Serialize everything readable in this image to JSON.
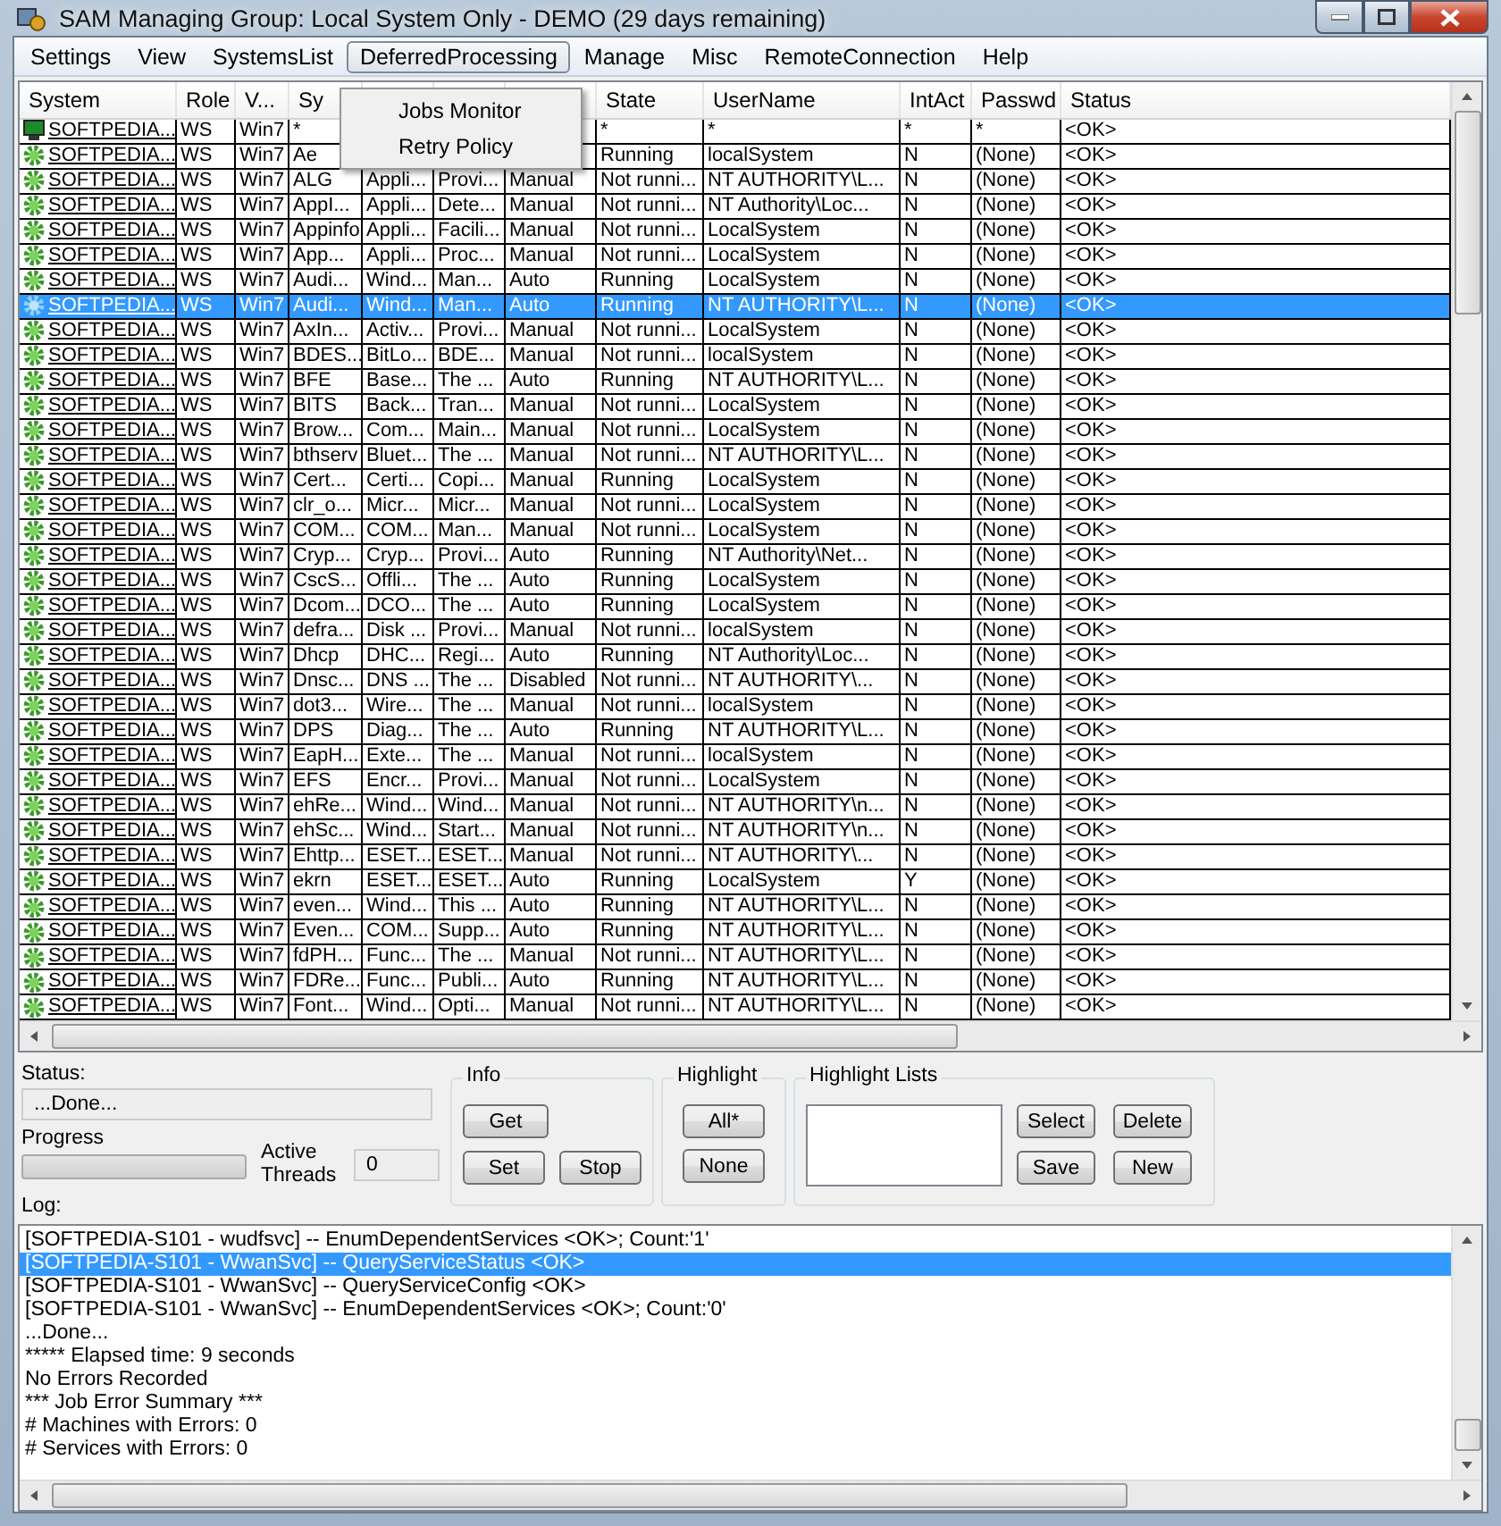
{
  "window": {
    "title": "SAM Managing Group: Local System Only - DEMO (29 days remaining)"
  },
  "menu_bar": [
    {
      "label": "Settings",
      "selected": false
    },
    {
      "label": "View",
      "selected": false
    },
    {
      "label": "SystemsList",
      "selected": false
    },
    {
      "label": "DeferredProcessing",
      "selected": true
    },
    {
      "label": "Manage",
      "selected": false
    },
    {
      "label": "Misc",
      "selected": false
    },
    {
      "label": "RemoteConnection",
      "selected": false
    },
    {
      "label": "Help",
      "selected": false
    }
  ],
  "open_menu": {
    "items": [
      "Jobs Monitor",
      "Retry Policy"
    ]
  },
  "table": {
    "columns": [
      {
        "label": "System"
      },
      {
        "label": "Role"
      },
      {
        "label": "V..."
      },
      {
        "label": "Sy"
      },
      {},
      {},
      {},
      {
        "label": "State"
      },
      {
        "label": "UserName"
      },
      {
        "label": "IntAct"
      },
      {
        "label": "Passwd"
      },
      {
        "label": "Status"
      }
    ],
    "rows": [
      {
        "kind": "computer",
        "selected": false,
        "cells": [
          "SOFTPEDIA...",
          "WS",
          "Win7",
          "*",
          "",
          "",
          "",
          "*",
          "*",
          "*",
          "*",
          "<OK>"
        ]
      },
      {
        "kind": "service",
        "selected": false,
        "cells": [
          "SOFTPEDIA...",
          "WS",
          "Win7",
          "Ae",
          "",
          "",
          "",
          "Running",
          "localSystem",
          "N",
          "(None)",
          "<OK>"
        ]
      },
      {
        "kind": "service",
        "selected": false,
        "cells": [
          "SOFTPEDIA...",
          "WS",
          "Win7",
          "ALG",
          "Appli...",
          "Provi...",
          "Manual",
          "Not runni...",
          "NT AUTHORITY\\L...",
          "N",
          "(None)",
          "<OK>"
        ]
      },
      {
        "kind": "service",
        "selected": false,
        "cells": [
          "SOFTPEDIA...",
          "WS",
          "Win7",
          "AppI...",
          "Appli...",
          "Dete...",
          "Manual",
          "Not runni...",
          "NT Authority\\Loc...",
          "N",
          "(None)",
          "<OK>"
        ]
      },
      {
        "kind": "service",
        "selected": false,
        "cells": [
          "SOFTPEDIA...",
          "WS",
          "Win7",
          "Appinfo",
          "Appli...",
          "Facili...",
          "Manual",
          "Not runni...",
          "LocalSystem",
          "N",
          "(None)",
          "<OK>"
        ]
      },
      {
        "kind": "service",
        "selected": false,
        "cells": [
          "SOFTPEDIA...",
          "WS",
          "Win7",
          "App...",
          "Appli...",
          "Proc...",
          "Manual",
          "Not runni...",
          "LocalSystem",
          "N",
          "(None)",
          "<OK>"
        ]
      },
      {
        "kind": "service",
        "selected": false,
        "cells": [
          "SOFTPEDIA...",
          "WS",
          "Win7",
          "Audi...",
          "Wind...",
          "Man...",
          "Auto",
          "Running",
          "LocalSystem",
          "N",
          "(None)",
          "<OK>"
        ]
      },
      {
        "kind": "service",
        "selected": true,
        "cells": [
          "SOFTPEDIA...",
          "WS",
          "Win7",
          "Audi...",
          "Wind...",
          "Man...",
          "Auto",
          "Running",
          "NT AUTHORITY\\L...",
          "N",
          "(None)",
          "<OK>"
        ]
      },
      {
        "kind": "service",
        "selected": false,
        "cells": [
          "SOFTPEDIA...",
          "WS",
          "Win7",
          "AxIn...",
          "Activ...",
          "Provi...",
          "Manual",
          "Not runni...",
          "LocalSystem",
          "N",
          "(None)",
          "<OK>"
        ]
      },
      {
        "kind": "service",
        "selected": false,
        "cells": [
          "SOFTPEDIA...",
          "WS",
          "Win7",
          "BDES...",
          "BitLo...",
          "BDE...",
          "Manual",
          "Not runni...",
          "localSystem",
          "N",
          "(None)",
          "<OK>"
        ]
      },
      {
        "kind": "service",
        "selected": false,
        "cells": [
          "SOFTPEDIA...",
          "WS",
          "Win7",
          "BFE",
          "Base...",
          "The ...",
          "Auto",
          "Running",
          "NT AUTHORITY\\L...",
          "N",
          "(None)",
          "<OK>"
        ]
      },
      {
        "kind": "service",
        "selected": false,
        "cells": [
          "SOFTPEDIA...",
          "WS",
          "Win7",
          "BITS",
          "Back...",
          "Tran...",
          "Manual",
          "Not runni...",
          "LocalSystem",
          "N",
          "(None)",
          "<OK>"
        ]
      },
      {
        "kind": "service",
        "selected": false,
        "cells": [
          "SOFTPEDIA...",
          "WS",
          "Win7",
          "Brow...",
          "Com...",
          "Main...",
          "Manual",
          "Not runni...",
          "LocalSystem",
          "N",
          "(None)",
          "<OK>"
        ]
      },
      {
        "kind": "service",
        "selected": false,
        "cells": [
          "SOFTPEDIA...",
          "WS",
          "Win7",
          "bthserv",
          "Bluet...",
          "The ...",
          "Manual",
          "Not runni...",
          "NT AUTHORITY\\L...",
          "N",
          "(None)",
          "<OK>"
        ]
      },
      {
        "kind": "service",
        "selected": false,
        "cells": [
          "SOFTPEDIA...",
          "WS",
          "Win7",
          "Cert...",
          "Certi...",
          "Copi...",
          "Manual",
          "Running",
          "LocalSystem",
          "N",
          "(None)",
          "<OK>"
        ]
      },
      {
        "kind": "service",
        "selected": false,
        "cells": [
          "SOFTPEDIA...",
          "WS",
          "Win7",
          "clr_o...",
          "Micr...",
          "Micr...",
          "Manual",
          "Not runni...",
          "LocalSystem",
          "N",
          "(None)",
          "<OK>"
        ]
      },
      {
        "kind": "service",
        "selected": false,
        "cells": [
          "SOFTPEDIA...",
          "WS",
          "Win7",
          "COM...",
          "COM...",
          "Man...",
          "Manual",
          "Not runni...",
          "LocalSystem",
          "N",
          "(None)",
          "<OK>"
        ]
      },
      {
        "kind": "service",
        "selected": false,
        "cells": [
          "SOFTPEDIA...",
          "WS",
          "Win7",
          "Cryp...",
          "Cryp...",
          "Provi...",
          "Auto",
          "Running",
          "NT Authority\\Net...",
          "N",
          "(None)",
          "<OK>"
        ]
      },
      {
        "kind": "service",
        "selected": false,
        "cells": [
          "SOFTPEDIA...",
          "WS",
          "Win7",
          "CscS...",
          "Offli...",
          "The ...",
          "Auto",
          "Running",
          "LocalSystem",
          "N",
          "(None)",
          "<OK>"
        ]
      },
      {
        "kind": "service",
        "selected": false,
        "cells": [
          "SOFTPEDIA...",
          "WS",
          "Win7",
          "Dcom...",
          "DCO...",
          "The ...",
          "Auto",
          "Running",
          "LocalSystem",
          "N",
          "(None)",
          "<OK>"
        ]
      },
      {
        "kind": "service",
        "selected": false,
        "cells": [
          "SOFTPEDIA...",
          "WS",
          "Win7",
          "defra...",
          "Disk ...",
          "Provi...",
          "Manual",
          "Not runni...",
          "localSystem",
          "N",
          "(None)",
          "<OK>"
        ]
      },
      {
        "kind": "service",
        "selected": false,
        "cells": [
          "SOFTPEDIA...",
          "WS",
          "Win7",
          "Dhcp",
          "DHC...",
          "Regi...",
          "Auto",
          "Running",
          "NT Authority\\Loc...",
          "N",
          "(None)",
          "<OK>"
        ]
      },
      {
        "kind": "service",
        "selected": false,
        "cells": [
          "SOFTPEDIA...",
          "WS",
          "Win7",
          "Dnsc...",
          "DNS ...",
          "The ...",
          "Disabled",
          "Not runni...",
          "NT AUTHORITY\\...",
          "N",
          "(None)",
          "<OK>"
        ]
      },
      {
        "kind": "service",
        "selected": false,
        "cells": [
          "SOFTPEDIA...",
          "WS",
          "Win7",
          "dot3...",
          "Wire...",
          "The ...",
          "Manual",
          "Not runni...",
          "localSystem",
          "N",
          "(None)",
          "<OK>"
        ]
      },
      {
        "kind": "service",
        "selected": false,
        "cells": [
          "SOFTPEDIA...",
          "WS",
          "Win7",
          "DPS",
          "Diag...",
          "The ...",
          "Auto",
          "Running",
          "NT AUTHORITY\\L...",
          "N",
          "(None)",
          "<OK>"
        ]
      },
      {
        "kind": "service",
        "selected": false,
        "cells": [
          "SOFTPEDIA...",
          "WS",
          "Win7",
          "EapH...",
          "Exte...",
          "The ...",
          "Manual",
          "Not runni...",
          "localSystem",
          "N",
          "(None)",
          "<OK>"
        ]
      },
      {
        "kind": "service",
        "selected": false,
        "cells": [
          "SOFTPEDIA...",
          "WS",
          "Win7",
          "EFS",
          "Encr...",
          "Provi...",
          "Manual",
          "Not runni...",
          "LocalSystem",
          "N",
          "(None)",
          "<OK>"
        ]
      },
      {
        "kind": "service",
        "selected": false,
        "cells": [
          "SOFTPEDIA...",
          "WS",
          "Win7",
          "ehRe...",
          "Wind...",
          "Wind...",
          "Manual",
          "Not runni...",
          "NT AUTHORITY\\n...",
          "N",
          "(None)",
          "<OK>"
        ]
      },
      {
        "kind": "service",
        "selected": false,
        "cells": [
          "SOFTPEDIA...",
          "WS",
          "Win7",
          "ehSc...",
          "Wind...",
          "Start...",
          "Manual",
          "Not runni...",
          "NT AUTHORITY\\n...",
          "N",
          "(None)",
          "<OK>"
        ]
      },
      {
        "kind": "service",
        "selected": false,
        "cells": [
          "SOFTPEDIA...",
          "WS",
          "Win7",
          "Ehttp...",
          "ESET...",
          "ESET...",
          "Manual",
          "Not runni...",
          "NT AUTHORITY\\...",
          "N",
          "(None)",
          "<OK>"
        ]
      },
      {
        "kind": "service",
        "selected": false,
        "cells": [
          "SOFTPEDIA...",
          "WS",
          "Win7",
          "ekrn",
          "ESET...",
          "ESET...",
          "Auto",
          "Running",
          "LocalSystem",
          "Y",
          "(None)",
          "<OK>"
        ]
      },
      {
        "kind": "service",
        "selected": false,
        "cells": [
          "SOFTPEDIA...",
          "WS",
          "Win7",
          "even...",
          "Wind...",
          "This ...",
          "Auto",
          "Running",
          "NT AUTHORITY\\L...",
          "N",
          "(None)",
          "<OK>"
        ]
      },
      {
        "kind": "service",
        "selected": false,
        "cells": [
          "SOFTPEDIA...",
          "WS",
          "Win7",
          "Even...",
          "COM...",
          "Supp...",
          "Auto",
          "Running",
          "NT AUTHORITY\\L...",
          "N",
          "(None)",
          "<OK>"
        ]
      },
      {
        "kind": "service",
        "selected": false,
        "cells": [
          "SOFTPEDIA...",
          "WS",
          "Win7",
          "fdPH...",
          "Func...",
          "The ...",
          "Manual",
          "Not runni...",
          "NT AUTHORITY\\L...",
          "N",
          "(None)",
          "<OK>"
        ]
      },
      {
        "kind": "service",
        "selected": false,
        "cells": [
          "SOFTPEDIA...",
          "WS",
          "Win7",
          "FDRe...",
          "Func...",
          "Publi...",
          "Auto",
          "Running",
          "NT AUTHORITY\\L...",
          "N",
          "(None)",
          "<OK>"
        ]
      },
      {
        "kind": "service",
        "selected": false,
        "cells": [
          "SOFTPEDIA...",
          "WS",
          "Win7",
          "Font...",
          "Wind...",
          "Opti...",
          "Manual",
          "Not runni...",
          "NT AUTHORITY\\L...",
          "N",
          "(None)",
          "<OK>"
        ]
      }
    ]
  },
  "status": {
    "label": "Status:",
    "value": "...Done..."
  },
  "progress": {
    "label": "Progress",
    "level": 0
  },
  "active_threads": {
    "label": "Active Threads",
    "value": "0"
  },
  "info_group": {
    "title": "Info",
    "buttons": [
      "Get",
      "Set",
      "Stop"
    ]
  },
  "highlight_group": {
    "title": "Highlight",
    "buttons": [
      "All*",
      "None"
    ]
  },
  "highlight_lists_group": {
    "title": "Highlight Lists",
    "buttons": [
      "Select",
      "Delete",
      "Save",
      "New"
    ]
  },
  "log": {
    "label": "Log:",
    "lines": [
      {
        "text": "[SOFTPEDIA-S101 - wudfsvc] -- EnumDependentServices <OK>; Count:'1'",
        "selected": false
      },
      {
        "text": "[SOFTPEDIA-S101 - WwanSvc] -- QueryServiceStatus <OK>",
        "selected": true
      },
      {
        "text": "[SOFTPEDIA-S101 - WwanSvc] -- QueryServiceConfig <OK>",
        "selected": false
      },
      {
        "text": "[SOFTPEDIA-S101 - WwanSvc] -- EnumDependentServices <OK>; Count:'0'",
        "selected": false
      },
      {
        "text": "...Done...",
        "selected": false
      },
      {
        "text": "***** Elapsed time: 9 seconds",
        "selected": false
      },
      {
        "text": "No Errors Recorded",
        "selected": false
      },
      {
        "text": "*** Job Error Summary ***",
        "selected": false
      },
      {
        "text": "# Machines with Errors: 0",
        "selected": false
      },
      {
        "text": "# Services with Errors: 0",
        "selected": false
      }
    ]
  }
}
